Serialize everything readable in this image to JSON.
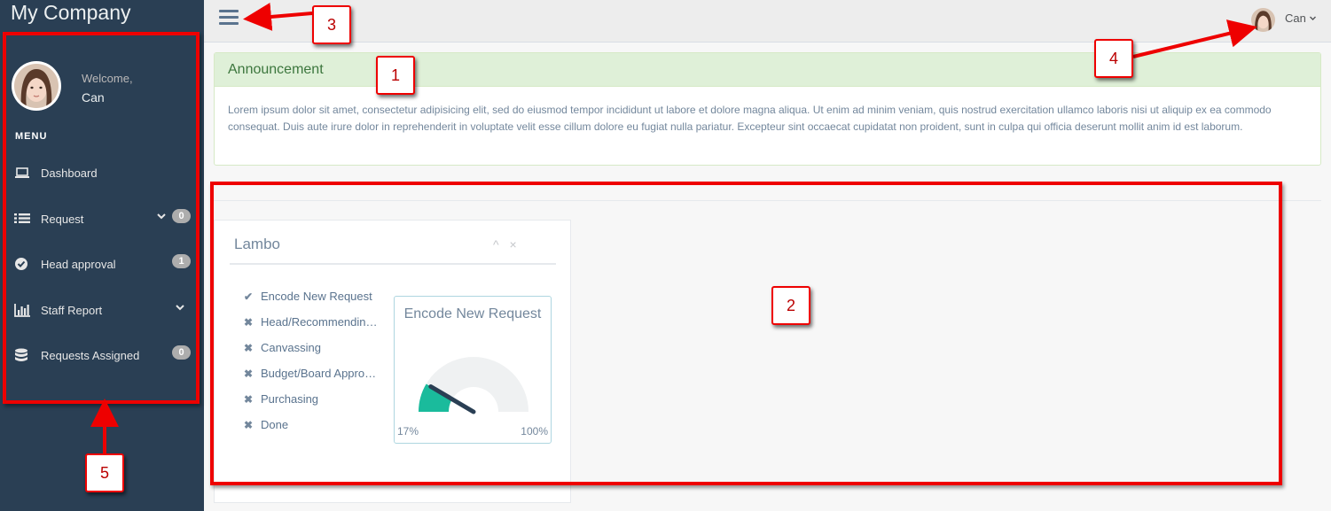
{
  "brand": "My Company",
  "profile": {
    "welcome": "Welcome,",
    "name": "Can"
  },
  "menu_title": "MENU",
  "nav": [
    {
      "label": "Dashboard",
      "icon": "laptop-icon"
    },
    {
      "label": "Request",
      "icon": "list-icon",
      "badge": "0",
      "expandable": true
    },
    {
      "label": "Head approval",
      "icon": "check-circle-icon",
      "badge": "1"
    },
    {
      "label": "Staff Report",
      "icon": "bar-chart-icon",
      "expandable": true
    },
    {
      "label": "Requests Assigned",
      "icon": "database-icon",
      "badge": "0"
    }
  ],
  "topbar": {
    "user": "Can"
  },
  "announcement": {
    "title": "Announcement",
    "body": "Lorem ipsum dolor sit amet, consectetur adipisicing elit, sed do eiusmod tempor incididunt ut labore et dolore magna aliqua. Ut enim ad minim veniam, quis nostrud exercitation ullamco laboris nisi ut aliquip ex ea commodo consequat. Duis aute irure dolor in reprehenderit in voluptate velit esse cillum dolore eu fugiat nulla pariatur. Excepteur sint occaecat cupidatat non proident, sunt in culpa qui officia deserunt mollit anim id est laborum."
  },
  "panel": {
    "title": "Lambo",
    "tools": [
      "^",
      "×"
    ],
    "steps": [
      {
        "mark": "✔",
        "label": "Encode New Request"
      },
      {
        "mark": "✖",
        "label": "Head/Recommending Approval"
      },
      {
        "mark": "✖",
        "label": "Canvassing"
      },
      {
        "mark": "✖",
        "label": "Budget/Board Approval"
      },
      {
        "mark": "✖",
        "label": "Purchasing"
      },
      {
        "mark": "✖",
        "label": "Done"
      }
    ],
    "gauge": {
      "title": "Encode New Request",
      "min_label": "17%",
      "max_label": "100%",
      "value": 0.17,
      "fill_color": "#1abb9c",
      "track_color": "#eff1f2",
      "needle_color": "#2a3f54"
    }
  },
  "callouts": [
    "1",
    "2",
    "3",
    "4",
    "5"
  ],
  "colors": {
    "sidebar": "#2a3f54",
    "annotation": "#ee0000",
    "accent": "#1abb9c"
  }
}
